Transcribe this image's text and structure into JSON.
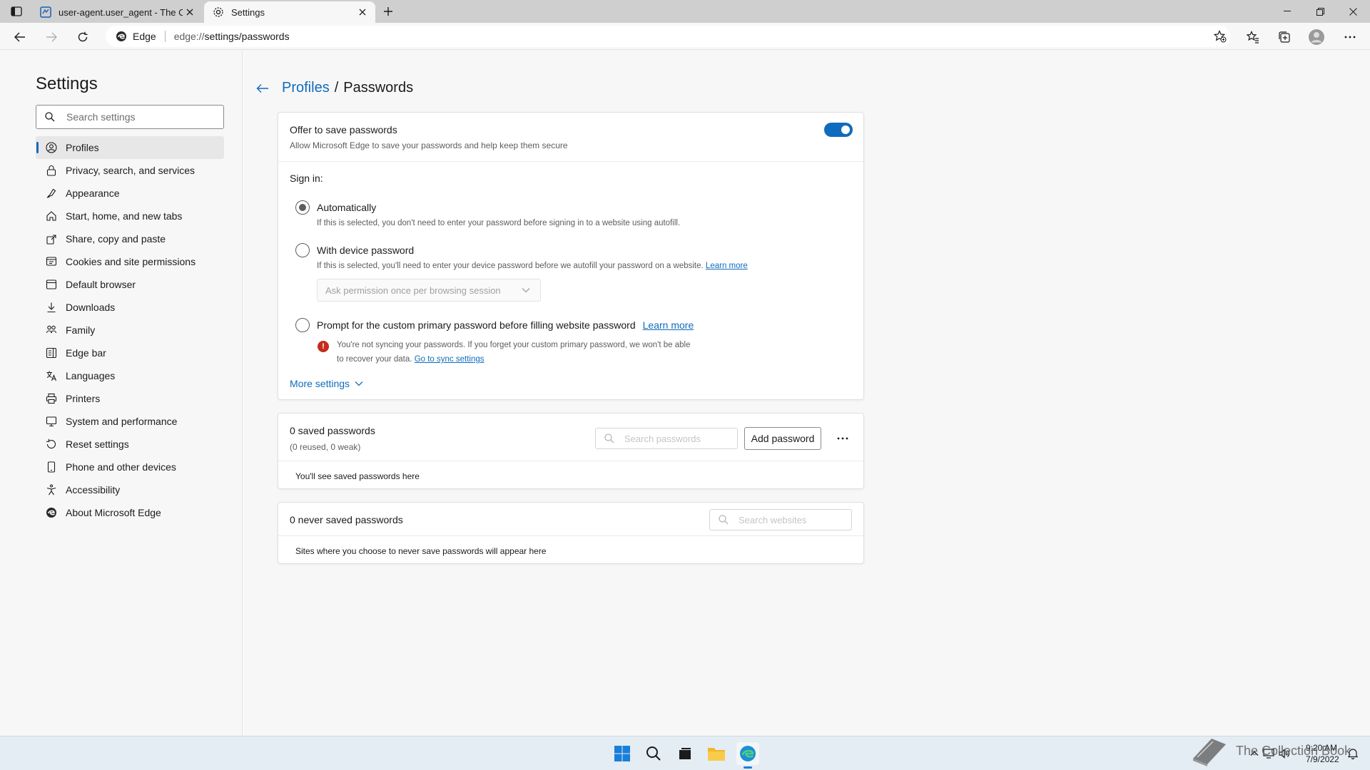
{
  "browser": {
    "tabs": [
      {
        "title": "user-agent.user_agent - The Coll",
        "active": false
      },
      {
        "title": "Settings",
        "active": true
      }
    ],
    "address": {
      "site_label": "Edge",
      "url_prefix": "edge://",
      "url_rest": "settings/passwords"
    }
  },
  "sidebar": {
    "title": "Settings",
    "search_placeholder": "Search settings",
    "items": [
      {
        "label": "Profiles",
        "icon": "profile-icon",
        "active": true
      },
      {
        "label": "Privacy, search, and services",
        "icon": "lock-icon"
      },
      {
        "label": "Appearance",
        "icon": "appearance-icon"
      },
      {
        "label": "Start, home, and new tabs",
        "icon": "home-icon"
      },
      {
        "label": "Share, copy and paste",
        "icon": "share-icon"
      },
      {
        "label": "Cookies and site permissions",
        "icon": "cookies-icon"
      },
      {
        "label": "Default browser",
        "icon": "browser-icon"
      },
      {
        "label": "Downloads",
        "icon": "download-icon"
      },
      {
        "label": "Family",
        "icon": "family-icon"
      },
      {
        "label": "Edge bar",
        "icon": "edge-bar-icon"
      },
      {
        "label": "Languages",
        "icon": "language-icon"
      },
      {
        "label": "Printers",
        "icon": "printer-icon"
      },
      {
        "label": "System and performance",
        "icon": "system-icon"
      },
      {
        "label": "Reset settings",
        "icon": "reset-icon"
      },
      {
        "label": "Phone and other devices",
        "icon": "phone-icon"
      },
      {
        "label": "Accessibility",
        "icon": "accessibility-icon"
      },
      {
        "label": "About Microsoft Edge",
        "icon": "edge-icon"
      }
    ]
  },
  "page": {
    "breadcrumb_parent": "Profiles",
    "breadcrumb_sep": "/",
    "breadcrumb_current": "Passwords",
    "offer": {
      "title": "Offer to save passwords",
      "subtitle": "Allow Microsoft Edge to save your passwords and help keep them secure",
      "toggle_on": true
    },
    "signin": {
      "label": "Sign in:",
      "auto_title": "Automatically",
      "auto_desc": "If this is selected, you don't need to enter your password before signing in to a website using autofill.",
      "device_title": "With device password",
      "device_desc": "If this is selected, you'll need to enter your device password before we autofill your password on a website.",
      "device_learn_more": "Learn more",
      "device_dropdown": "Ask permission once per browsing session",
      "custom_title": "Prompt for the custom primary password before filling website password",
      "custom_learn_more": "Learn more",
      "warn_line1": "You're not syncing your passwords. If you forget your custom primary password, we won't be able",
      "warn_line2": "to recover your data.",
      "warn_link": "Go to sync settings",
      "selected": "Automatically"
    },
    "more_settings": "More settings",
    "saved": {
      "title": "0 saved passwords",
      "subtitle": "(0 reused, 0 weak)",
      "search_placeholder": "Search passwords",
      "add_button": "Add password",
      "empty_text": "You'll see saved passwords here"
    },
    "never_saved": {
      "title": "0 never saved passwords",
      "search_placeholder": "Search websites",
      "empty_text": "Sites where you choose to never save passwords will appear here"
    }
  },
  "taskbar": {
    "time": "9:20 AM",
    "date": "7/9/2022",
    "watermark": "The Collection Book"
  },
  "colors": {
    "accent": "#0f6cbd",
    "warning": "#c42b1c",
    "taskbar": "#e4ecf4"
  }
}
